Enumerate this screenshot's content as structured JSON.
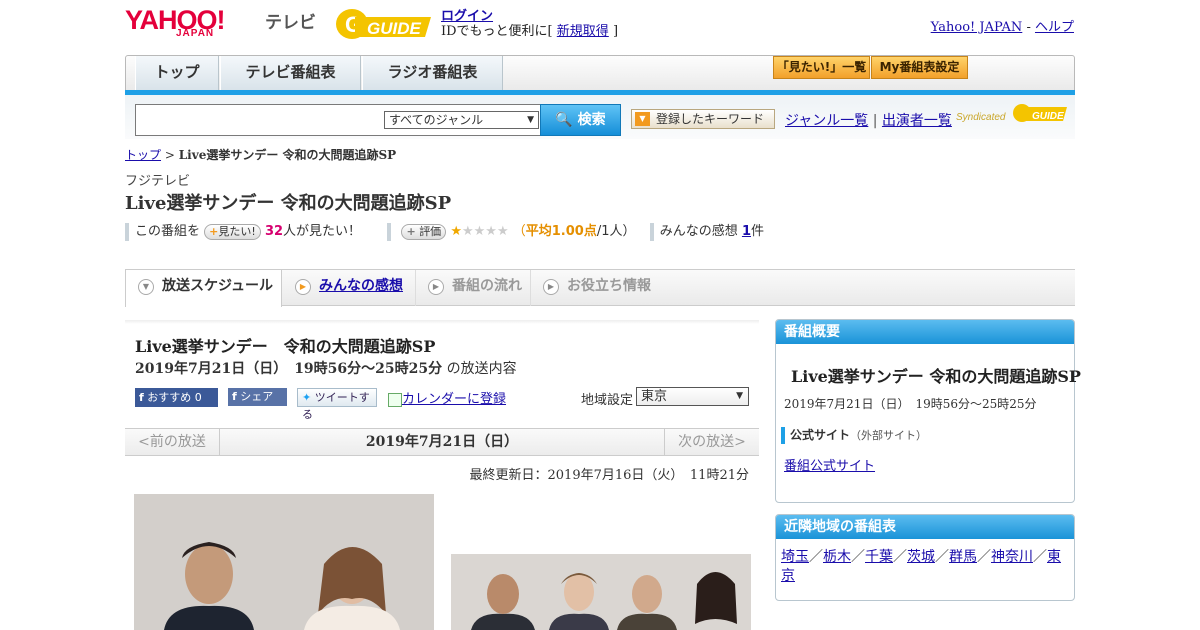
{
  "header": {
    "logo_yahoo": "YAHOO!",
    "logo_japan": "JAPAN",
    "logo_tv": "テレビ",
    "logo_guide": "GUIDE",
    "login": "ログイン",
    "id_text": "IDでもっと便利に[",
    "signup": "新規取得",
    "id_close": "]",
    "yahoo_japan_link": "Yahoo! JAPAN",
    "sep": "-",
    "help": "ヘルプ"
  },
  "nav": {
    "tabs": [
      {
        "label": "トップ"
      },
      {
        "label": "テレビ番組表"
      },
      {
        "label": "ラジオ番組表"
      }
    ],
    "mitai_list": "「見たい!」一覧",
    "my_settings": "My番組表設定"
  },
  "search": {
    "placeholder": "",
    "genre_selected": "すべてのジャンル",
    "search_button": "検索",
    "keyword_button": "登録したキーワード",
    "genre_list": "ジャンル一覧",
    "pipe": "|",
    "performer_list": "出演者一覧",
    "syndicated": "Syndicated"
  },
  "breadcrumb": {
    "top": "トップ",
    "sep": ">",
    "current": "Live選挙サンデー 令和の大問題追跡SP"
  },
  "program": {
    "station": "フジテレビ",
    "title": "Live選挙サンデー 令和の大問題追跡SP",
    "this_program": "この番組を",
    "mitai_btn": "見たい!",
    "mitai_count": "32",
    "mitai_suffix": "人が見たい！",
    "hyoka_btn": "評価",
    "rating_stars": 1,
    "rating_avg_label": "（",
    "rating_avg": "平均1.00点",
    "rating_people": "/1人）",
    "kanso_label": "みんなの感想",
    "kanso_count": "1",
    "kanso_suffix": "件"
  },
  "content_tabs": [
    {
      "label": "放送スケジュール"
    },
    {
      "label": "みんなの感想"
    },
    {
      "label": "番組の流れ"
    },
    {
      "label": "お役立ち情報"
    }
  ],
  "broadcast": {
    "title": "Live選挙サンデー　令和の大問題追跡SP",
    "datetime": "2019年7月21日（日）　19時56分～25時25分",
    "suffix": "の放送内容",
    "fb_like": "おすすめ 0",
    "fb_share": "シェア",
    "tweet": "ツイートする",
    "calendar": "カレンダーに登録",
    "region_label": "地域設定",
    "region_selected": "東京",
    "prev": "<前の放送",
    "date": "2019年7月21日（日）",
    "next": "次の放送>",
    "updated": "最終更新日：2019年7月16日（火）　11時21分"
  },
  "side": {
    "overview_header": "番組概要",
    "overview_title": "Live選挙サンデー 令和の大問題追跡SP",
    "overview_time": "2019年7月21日（日）　19時56分～25時25分",
    "official_label": "公式サイト",
    "official_note": "（外部サイト）",
    "official_link": "番組公式サイト",
    "nearby_header": "近隣地域の番組表",
    "nearby": [
      "埼玉",
      "栃木",
      "千葉",
      "茨城",
      "群馬",
      "神奈川",
      "東京"
    ],
    "nearby_sep": "／"
  },
  "colors": {
    "yahoo_red": "#e4003b",
    "accent_blue": "#1ea0e6",
    "link": "#1a0dab",
    "orange": "#f29a1f"
  }
}
